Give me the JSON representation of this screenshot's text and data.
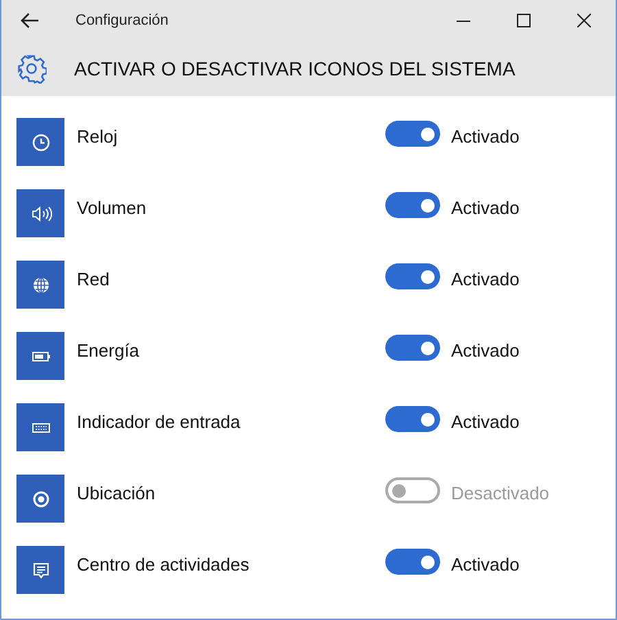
{
  "window": {
    "title": "Configuración"
  },
  "header": {
    "title": "ACTIVAR O DESACTIVAR ICONOS DEL SISTEMA"
  },
  "items": [
    {
      "kind": "clock",
      "label": "Reloj",
      "on": true,
      "state_label": "Activado"
    },
    {
      "kind": "volume",
      "label": "Volumen",
      "on": true,
      "state_label": "Activado"
    },
    {
      "kind": "network",
      "label": "Red",
      "on": true,
      "state_label": "Activado"
    },
    {
      "kind": "power",
      "label": "Energía",
      "on": true,
      "state_label": "Activado"
    },
    {
      "kind": "keyboard",
      "label": "Indicador de entrada",
      "on": true,
      "state_label": "Activado"
    },
    {
      "kind": "location",
      "label": "Ubicación",
      "on": false,
      "state_label": "Desactivado"
    },
    {
      "kind": "action",
      "label": "Centro de actividades",
      "on": true,
      "state_label": "Activado"
    }
  ]
}
